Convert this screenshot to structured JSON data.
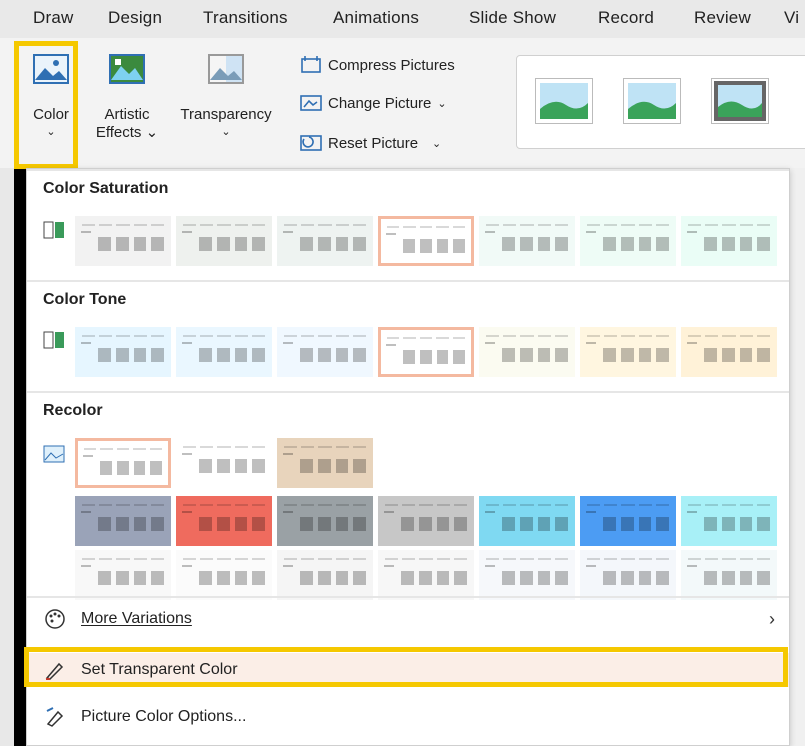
{
  "menubar": {
    "tabs": [
      "Draw",
      "Design",
      "Transitions",
      "Animations",
      "Slide Show",
      "Record",
      "Review",
      "Vi"
    ]
  },
  "ribbon": {
    "color_label": "Color",
    "artistic_line1": "Artistic",
    "artistic_line2": "Effects",
    "transparency_label": "Transparency",
    "compress_label": "Compress Pictures",
    "change_label": "Change Picture",
    "reset_label": "Reset Picture"
  },
  "dropdown": {
    "sections": {
      "saturation": "Color Saturation",
      "tone": "Color Tone",
      "recolor": "Recolor"
    },
    "saturation_colors": [
      "#f2f2f2",
      "#eef1ee",
      "#eef3f1",
      "#ffffff",
      "#f1faf7",
      "#eefcf6",
      "#eafdf6"
    ],
    "tone_colors": [
      "#e6f6ff",
      "#eaf7ff",
      "#f0f8ff",
      "#ffffff",
      "#fbfbf1",
      "#fff6e0",
      "#fff2d8"
    ],
    "recolor_row1": [
      "#ffffff",
      "#ffffff",
      "#e8d4bc"
    ],
    "recolor_row2": [
      "#9aa3b8",
      "#ef6b5e",
      "#9aa1a5",
      "#c7c7c7",
      "#7fd9f2",
      "#4c9cf3",
      "#a8f0f7"
    ],
    "recolor_row3": [
      "#f8f8f8",
      "#fbfbfb",
      "#f5f5f5",
      "#f7f7f7",
      "#f6f8fb",
      "#f4f7fb",
      "#f3f9fa"
    ],
    "items": {
      "more_variations": "More Variations",
      "set_transparent": "Set Transparent Color",
      "picture_color_options": "Picture Color Options..."
    }
  },
  "colors": {
    "highlight": "#f5c800",
    "selection_border": "#f4b9a0"
  }
}
